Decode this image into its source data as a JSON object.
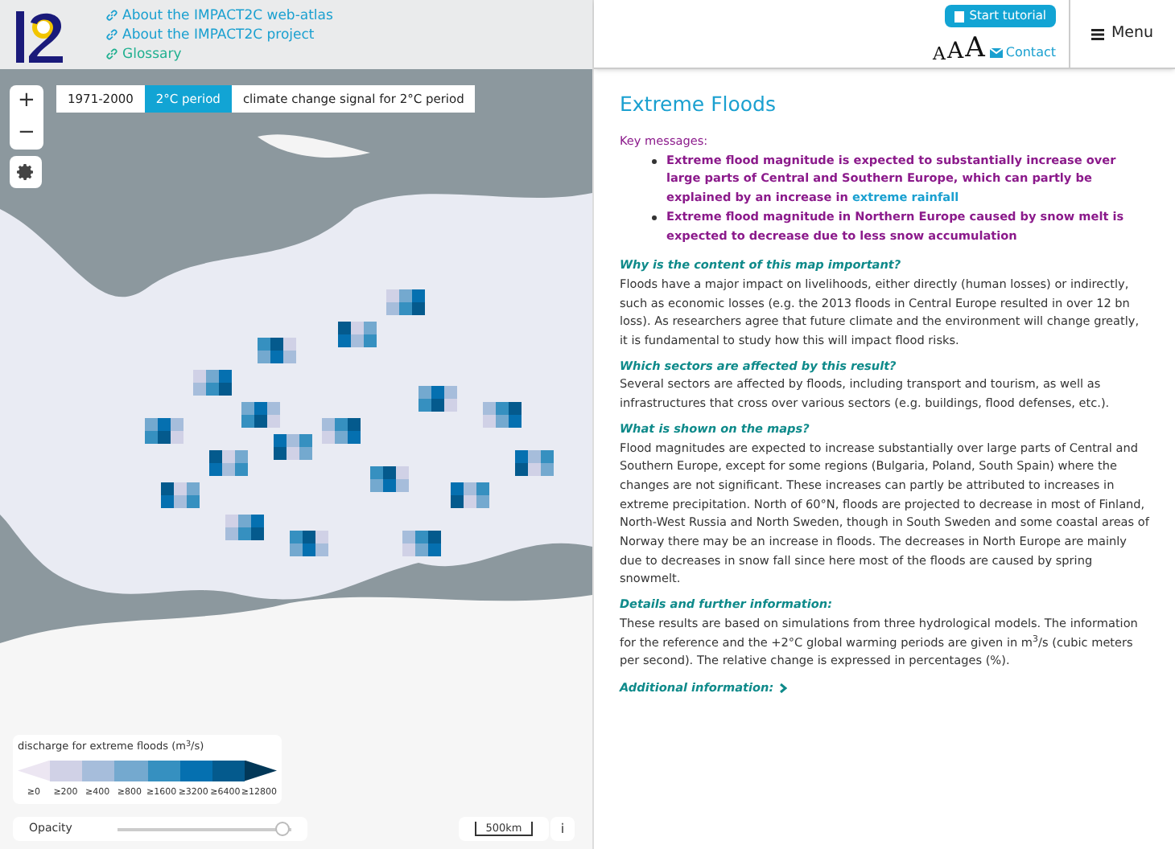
{
  "header": {
    "links": [
      "About the IMPACT2C web-atlas",
      "About the IMPACT2C project",
      "Glossary"
    ],
    "tutorial_button": "Start tutorial",
    "font_sizes": [
      "A",
      "A",
      "A"
    ],
    "contact": "Contact",
    "menu": "Menu"
  },
  "map": {
    "zoom_in": "+",
    "zoom_out": "−",
    "tabs": [
      {
        "label": "1971-2000",
        "selected": false
      },
      {
        "label": "2°C period",
        "selected": true
      },
      {
        "label": "climate change signal for 2°C period",
        "selected": false
      }
    ],
    "legend": {
      "title": "discharge for extreme floods (m$^{3}$/s)",
      "classes": [
        {
          "label": "≥0",
          "color": "#ece6f2"
        },
        {
          "label": "≥200",
          "color": "#d0d1e6"
        },
        {
          "label": "≥400",
          "color": "#a6bddb"
        },
        {
          "label": "≥800",
          "color": "#74a9cf"
        },
        {
          "label": "≥1600",
          "color": "#3690c0"
        },
        {
          "label": "≥3200",
          "color": "#0570b0"
        },
        {
          "label": "≥6400",
          "color": "#045a8d"
        },
        {
          "label": "≥12800",
          "color": "#023858"
        }
      ]
    },
    "opacity": {
      "label": "Opacity",
      "level": 0.95
    },
    "scale": "500km",
    "info": "i"
  },
  "article": {
    "title": "Extreme Floods",
    "key_messages_label": "Key messages:",
    "key_messages": [
      {
        "text": "Extreme flood magnitude is expected to substantially increase over large parts of Central and Southern Europe, which can partly be explained by an increase in",
        "link": "extreme rainfall"
      },
      {
        "text": "Extreme flood magnitude in Northern Europe caused by snow melt is expected to decrease due to less snow accumulation"
      }
    ],
    "sections": [
      {
        "heading": "Why is the content of this map important?",
        "body": "Floods have a major impact on livelihoods, either directly (human losses) or indirectly, such as economic losses (e.g. the 2013 floods in Central Europe resulted in over 12 bn loss). As researchers agree that future climate and the environment will change greatly, it is fundamental to study how this will impact flood risks."
      },
      {
        "heading": "Which sectors are affected by this result?",
        "body": "Several sectors are affected by floods, including transport and tourism, as well as infrastructures that cross over various sectors (e.g. buildings, flood defenses, etc.)."
      },
      {
        "heading": "What is shown on the maps?",
        "body": "Flood magnitudes are expected to increase substantially over large parts of Central and Southern Europe, except for some regions (Bulgaria, Poland, South Spain) where the changes are not significant. These increases can partly be attributed to increases in extreme precipitation. North of 60°N, floods are projected to decrease in most of Finland, North-West Russia and North Sweden, though in South Sweden and some coastal areas of Norway there may be an increase in floods. The decreases in North Europe are mainly due to decreases in snow fall since here most of the floods are caused by spring snowmelt."
      },
      {
        "heading": "Details and further information:",
        "body": "These results are based on simulations from three hydrological models. The information for the reference and the +2°C global warming periods are given in m$^{3}$/s (cubic meters per second). The relative change is expressed in percentages (%)."
      }
    ],
    "additional": "Additional information:"
  }
}
